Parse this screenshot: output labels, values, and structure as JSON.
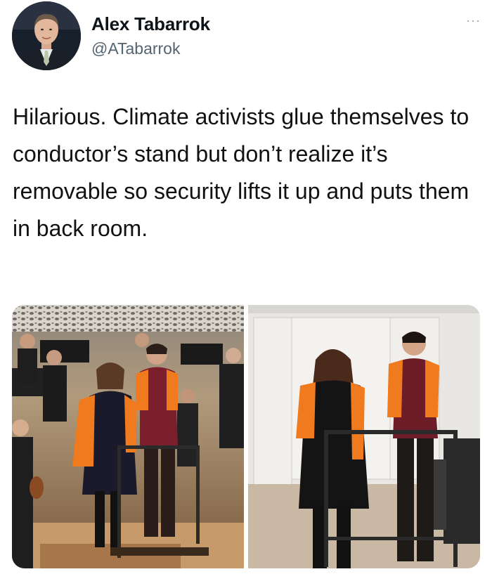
{
  "tweet": {
    "author": {
      "display_name": "Alex Tabarrok",
      "handle": "@ATabarrok",
      "avatar_icon": "profile-photo"
    },
    "more_icon": "more-options-icon",
    "more_glyph": "···",
    "text": "Hilarious. Climate activists glue themselves to conductor’s stand but don’t realize it’s removable so security lifts it up and puts them in back room.",
    "media": [
      {
        "name": "concert-hall-photo"
      },
      {
        "name": "back-room-photo"
      }
    ]
  },
  "colors": {
    "text": "#0f1419",
    "handle": "#536471",
    "vest": "#f07a1e"
  }
}
